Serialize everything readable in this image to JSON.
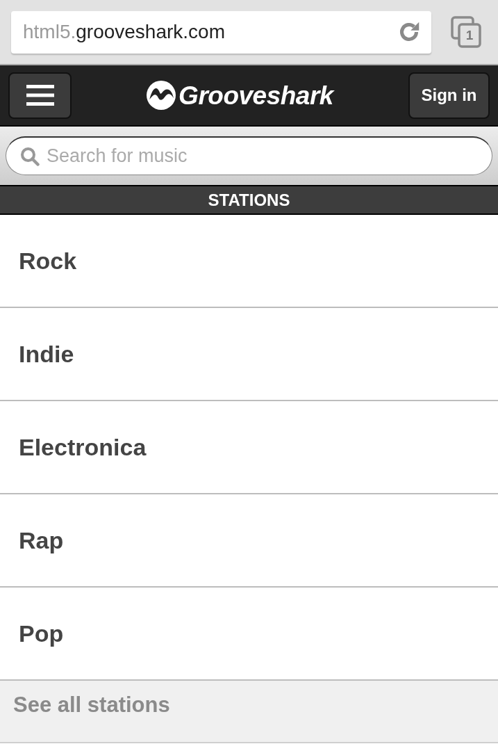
{
  "browser": {
    "url_prefix": "html5.",
    "url_host": "grooveshark.com",
    "tab_count": "1"
  },
  "header": {
    "logo": "Grooveshark",
    "sign_in": "Sign in"
  },
  "search": {
    "placeholder": "Search for music"
  },
  "stations": {
    "title": "STATIONS",
    "items": [
      "Rock",
      "Indie",
      "Electronica",
      "Rap",
      "Pop"
    ],
    "see_all": "See all stations"
  }
}
